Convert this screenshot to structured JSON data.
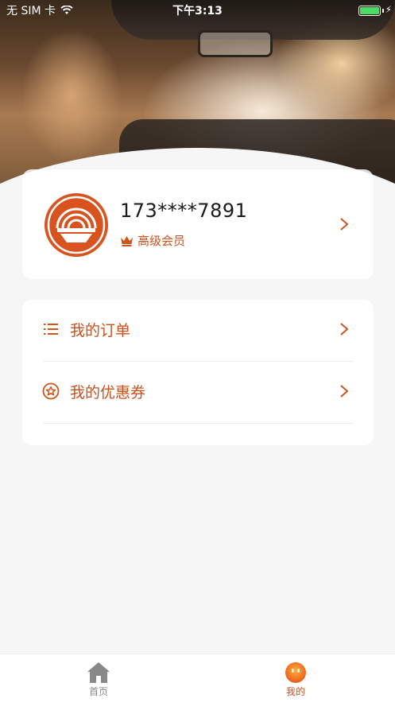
{
  "status_bar": {
    "carrier": "无 SIM 卡",
    "time": "下午3:13",
    "battery_level": 1.0
  },
  "profile": {
    "phone": "173****7891",
    "membership": "高级会员",
    "member_icon": "crown-icon",
    "avatar_icon": "brand-logo-icon"
  },
  "menu": {
    "items": [
      {
        "label": "我的订单",
        "icon": "list-icon"
      },
      {
        "label": "我的优惠券",
        "icon": "star-coupon-icon"
      }
    ]
  },
  "tabs": [
    {
      "label": "首页",
      "icon": "home-icon",
      "active": false
    },
    {
      "label": "我的",
      "icon": "smiley-icon",
      "active": true
    }
  ],
  "colors": {
    "accent": "#d0531c",
    "battery": "#4cd964",
    "inactive_tab": "#888888"
  }
}
